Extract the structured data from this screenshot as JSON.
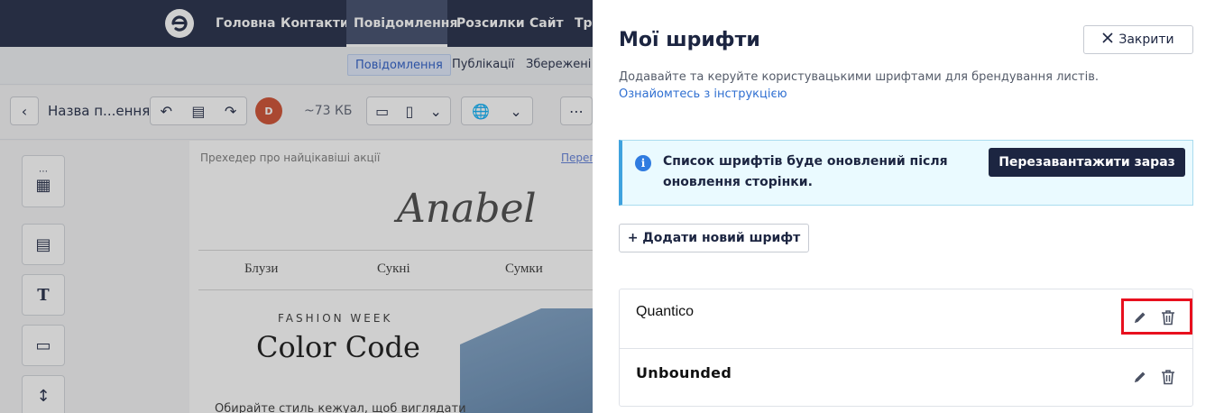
{
  "topnav": {
    "items": [
      "Головна",
      "Контакти",
      "Повідомлення",
      "Розсилки",
      "Сайт",
      "Три"
    ],
    "active": "Повідомлення"
  },
  "subnav": {
    "tabs": [
      "Повідомлення",
      "Публікації",
      "Збережені ш"
    ],
    "active": "Повідомлення"
  },
  "editor": {
    "message_name": "Назва п...ення",
    "avatar_initial": "D",
    "size": "~73 КБ"
  },
  "email_preview": {
    "preheader": "Прехедер про найцікавіші акції",
    "preheader_link": "Перег",
    "brand": "Anabel",
    "menu": [
      "Блузи",
      "Сукні",
      "Сумки"
    ],
    "eyebrow": "FASHION WEEK",
    "headline": "Color Code",
    "body": "Обирайте стиль кежуал, щоб виглядати"
  },
  "panel": {
    "title": "Мої шрифти",
    "close_label": "Закрити",
    "description": "Додавайте та керуйте користувацькими шрифтами для брендування листів.",
    "guide_link": "Ознайомтесь з інструкцією",
    "info": {
      "text": "Список шрифтів буде оновлений після оновлення сторінки.",
      "button": "Перезавантажити зараз"
    },
    "add_button": "+ Додати новий шрифт",
    "fonts": [
      {
        "name": "Quantico"
      },
      {
        "name": "Unbounded"
      }
    ]
  },
  "colors": {
    "navy": "#1c2541",
    "info_bg": "#eafaff",
    "info_border": "#3fa2de",
    "link": "#2f6fd1",
    "highlight": "#e8101e"
  }
}
